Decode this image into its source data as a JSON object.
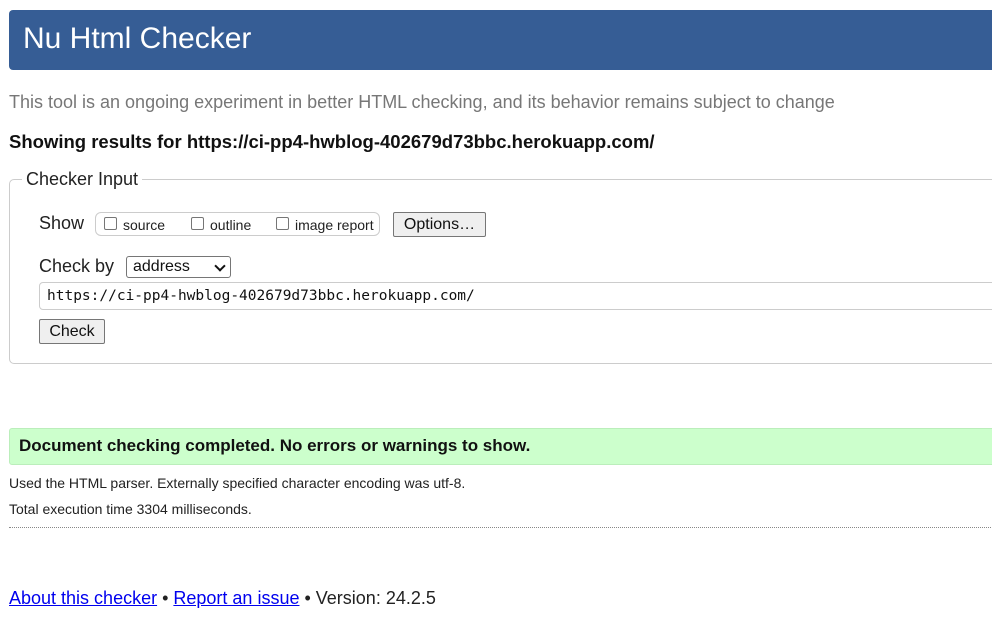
{
  "header": {
    "title": "Nu Html Checker"
  },
  "tagline": "This tool is an ongoing experiment in better HTML checking, and its behavior remains subject to change",
  "showing_results": "Showing results for https://ci-pp4-hwblog-402679d73bbc.herokuapp.com/",
  "checker_input": {
    "legend": "Checker Input",
    "show_label": "Show",
    "show_options": [
      {
        "label": "source",
        "checked": false
      },
      {
        "label": "outline",
        "checked": false
      },
      {
        "label": "image report",
        "checked": false
      }
    ],
    "options_button": "Options…",
    "check_by_label": "Check by",
    "check_by_selected": "address",
    "url_value": "https://ci-pp4-hwblog-402679d73bbc.herokuapp.com/",
    "check_button": "Check"
  },
  "result": {
    "message": "Document checking completed. No errors or warnings to show.",
    "parser_info": "Used the HTML parser. Externally specified character encoding was utf-8.",
    "execution_time": "Total execution time 3304 milliseconds."
  },
  "footer": {
    "about_link": "About this checker",
    "separator": " • ",
    "report_link": "Report an issue",
    "version_text": "Version: 24.2.5"
  },
  "colors": {
    "header_bg": "#365d95",
    "success_bg": "#ccffcc",
    "link": "#0000ee"
  }
}
